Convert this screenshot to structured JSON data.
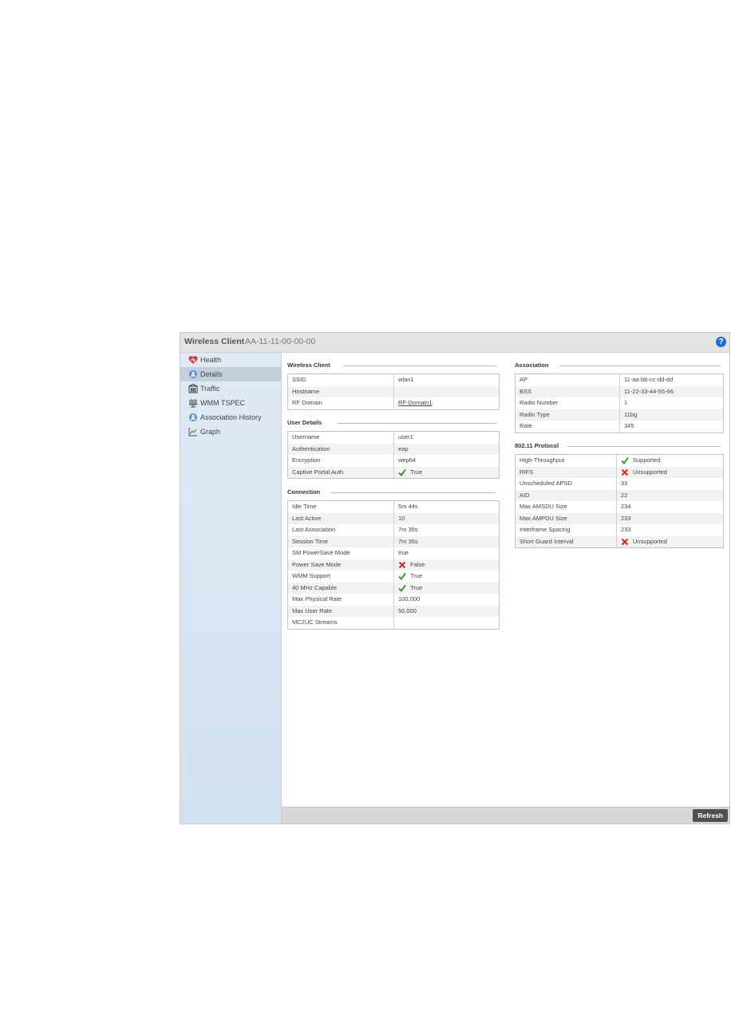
{
  "panel": {
    "title": "Wireless Client",
    "subtitle": "AA-11-11-00-00-00",
    "help_icon": "question-icon",
    "refresh_label": "Refresh"
  },
  "sidebar": {
    "items": [
      {
        "label": "Health",
        "icon": "heart-icon"
      },
      {
        "label": "Details",
        "icon": "details-icon"
      },
      {
        "label": "Traffic",
        "icon": "traffic-icon"
      },
      {
        "label": "WMM TSPEC",
        "icon": "wmm-icon"
      },
      {
        "label": "Association History",
        "icon": "history-icon"
      },
      {
        "label": "Graph",
        "icon": "graph-icon"
      }
    ]
  },
  "wireless_client": {
    "title": "Wireless Client",
    "rows": [
      {
        "key": "SSID",
        "value": "wlan1"
      },
      {
        "key": "Hostname",
        "value": ""
      },
      {
        "key": "RF Domain",
        "value": "RF-Domain1"
      }
    ]
  },
  "user_details": {
    "title": "User Details",
    "rows": [
      {
        "key": "Username",
        "value": "user1"
      },
      {
        "key": "Authentication",
        "value": "eap"
      },
      {
        "key": "Encryption",
        "value": "wep64"
      },
      {
        "key": "Captive Portal Auth",
        "value": "True"
      }
    ]
  },
  "connection": {
    "title": "Connection",
    "rows": [
      {
        "key": "Idle Time",
        "value": "5m 44s"
      },
      {
        "key": "Last Active",
        "value": "10"
      },
      {
        "key": "Last Association",
        "value": "7m 35s"
      },
      {
        "key": "Session Time",
        "value": "7m 35s"
      },
      {
        "key": "SM PowerSave Mode",
        "value": "true"
      },
      {
        "key": "Power Save Mode",
        "value": "False"
      },
      {
        "key": "WMM Support",
        "value": "True"
      },
      {
        "key": "40 MHz Capable",
        "value": "True"
      },
      {
        "key": "Max Physical Rate",
        "value": "100,000"
      },
      {
        "key": "Max User Rate",
        "value": "50,000"
      },
      {
        "key": "MC2UC Streams",
        "value": ""
      }
    ]
  },
  "association": {
    "title": "Association",
    "rows": [
      {
        "key": "AP",
        "value": "11-aa-bb-cc-dd-dd"
      },
      {
        "key": "BSS",
        "value": "11-22-33-44-55-66"
      },
      {
        "key": "Radio Number",
        "value": "1"
      },
      {
        "key": "Radio Type",
        "value": "11bg"
      },
      {
        "key": "Rate",
        "value": "345"
      }
    ]
  },
  "protocol": {
    "title": "802.11 Protocol",
    "rows": [
      {
        "key": "High-Throughput",
        "value": "Supported"
      },
      {
        "key": "RIFS",
        "value": "Unsupported"
      },
      {
        "key": "Unscheduled APSD",
        "value": "33"
      },
      {
        "key": "AID",
        "value": "22"
      },
      {
        "key": "Max AMSDU Size",
        "value": "234"
      },
      {
        "key": "Max AMPDU Size",
        "value": "233"
      },
      {
        "key": "Interframe Spacing",
        "value": "233"
      },
      {
        "key": "Short Guard Interval",
        "value": "Unsupported"
      }
    ]
  },
  "colors": {
    "check": "#3a9a2a",
    "cross": "#d42a1e",
    "help": "#1d6fd1"
  }
}
